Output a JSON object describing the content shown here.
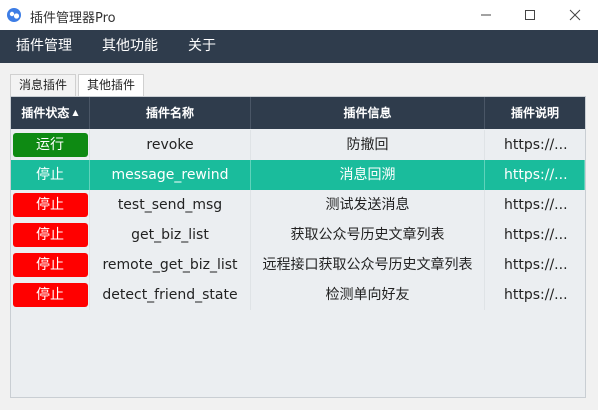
{
  "window": {
    "title": "插件管理器Pro",
    "icon": "app-logo-icon",
    "controls": {
      "minimize": "minimize-icon",
      "maximize": "maximize-icon",
      "close": "close-icon"
    }
  },
  "menu": {
    "items": [
      "插件管理",
      "其他功能",
      "关于"
    ]
  },
  "tabs": [
    "消息插件",
    "其他插件"
  ],
  "active_tab": "其他插件",
  "table": {
    "columns": [
      "插件状态",
      "插件名称",
      "插件信息",
      "插件说明"
    ],
    "sorted_column": "插件状态",
    "rows": [
      {
        "status": "运行",
        "name": "revoke",
        "info": "防撤回",
        "desc": "https://...",
        "selected": false
      },
      {
        "status": "停止",
        "name": "message_rewind",
        "info": "消息回溯",
        "desc": "https://...",
        "selected": true
      },
      {
        "status": "停止",
        "name": "test_send_msg",
        "info": "测试发送消息",
        "desc": "https://...",
        "selected": false
      },
      {
        "status": "停止",
        "name": "get_biz_list",
        "info": "获取公众号历史文章列表",
        "desc": "https://...",
        "selected": false
      },
      {
        "status": "停止",
        "name": "remote_get_biz_list",
        "info": "远程接口获取公众号历史文章列表",
        "desc": "https://...",
        "selected": false
      },
      {
        "status": "停止",
        "name": "detect_friend_state",
        "info": "检测单向好友",
        "desc": "https://...",
        "selected": false
      }
    ]
  },
  "colors": {
    "header_bg": "#2f3c4c",
    "selected_row": "#1abc9c",
    "running": "#0e8a13",
    "stopped": "#ff0000"
  }
}
